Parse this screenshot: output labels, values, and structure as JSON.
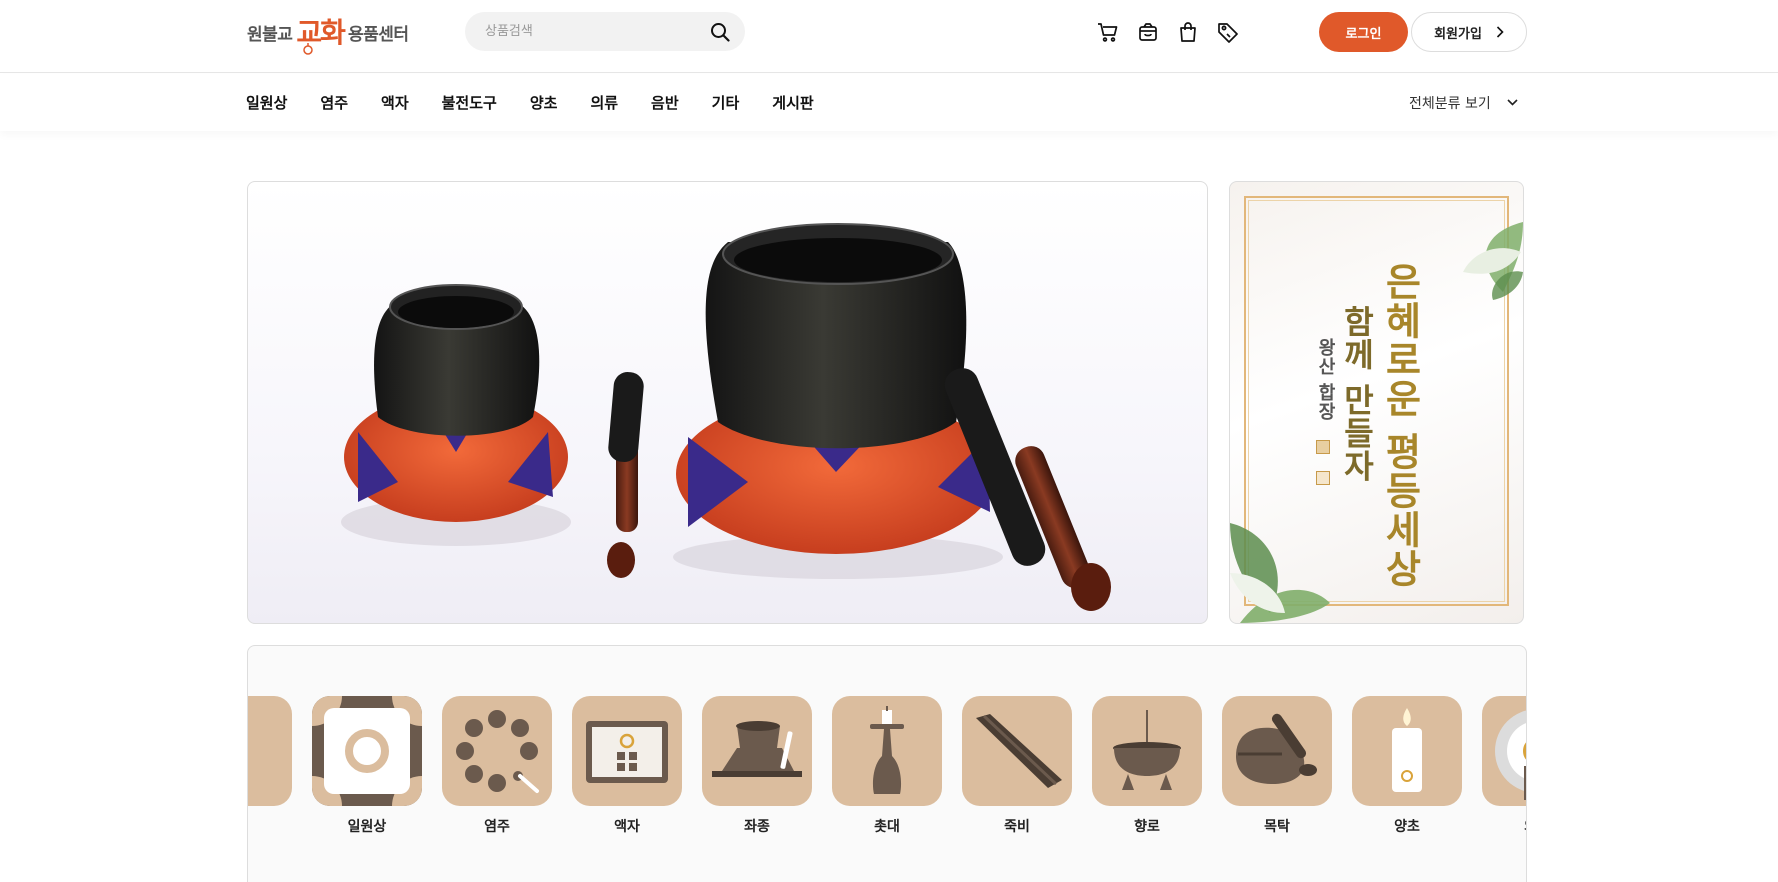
{
  "header": {
    "logo": {
      "prefix": "원불교",
      "brand": "교화",
      "suffix": "용품센터"
    },
    "search": {
      "placeholder": "상품검색",
      "value": ""
    },
    "icons": [
      "cart-icon",
      "shopping-basket-icon",
      "shopping-bag-icon",
      "tag-icon"
    ],
    "login_label": "로그인",
    "join_label": "회원가입"
  },
  "nav": {
    "items": [
      "일원상",
      "염주",
      "액자",
      "불전도구",
      "양초",
      "의류",
      "음반",
      "기타",
      "게시판"
    ],
    "all_label": "전체분류 보기"
  },
  "banner_side": {
    "line1": "은혜로운 평등세상",
    "line2": "함께 만들자",
    "author": "왕산 합장"
  },
  "categories": [
    {
      "label": "",
      "icon": "partial-icon"
    },
    {
      "label": "일원상",
      "icon": "irwonsang-icon"
    },
    {
      "label": "염주",
      "icon": "prayer-beads-icon"
    },
    {
      "label": "액자",
      "icon": "frame-icon"
    },
    {
      "label": "좌종",
      "icon": "singing-bowl-icon"
    },
    {
      "label": "촛대",
      "icon": "candlestick-icon"
    },
    {
      "label": "죽비",
      "icon": "bamboo-clapper-icon"
    },
    {
      "label": "향로",
      "icon": "incense-burner-icon"
    },
    {
      "label": "목탁",
      "icon": "moktak-icon"
    },
    {
      "label": "양초",
      "icon": "candle-icon"
    },
    {
      "label": "의류",
      "icon": "clothing-icon"
    }
  ],
  "colors": {
    "accent": "#e0592a",
    "category_bg": "#dbbd9e",
    "icon_dark": "#6b5a4d",
    "gold": "#a8862a"
  }
}
